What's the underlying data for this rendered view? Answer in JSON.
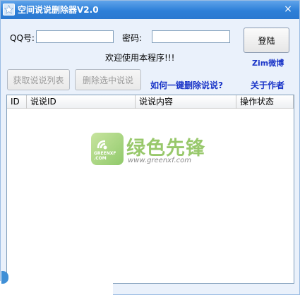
{
  "window": {
    "title": "空间说说删除器V2.0",
    "close_glyph": "×"
  },
  "form": {
    "qq_label": "QQ号:",
    "qq_value": "",
    "password_label": "密码:",
    "password_value": "",
    "login_button": "登陆",
    "welcome_text": "欢迎使用本程序!!!",
    "weibo_link": "Zim微博"
  },
  "actions": {
    "fetch_button": "获取说说列表",
    "delete_button": "删除选中说说",
    "one_click_link": "如何一键删除说说?",
    "about_link": "关于作者"
  },
  "list": {
    "columns": [
      "ID",
      "说说ID",
      "说说内容",
      "操作状态"
    ],
    "rows": []
  },
  "watermark": {
    "logo_text": "GREENXF .COM",
    "site_name": "绿色先锋",
    "url": "www.greenxf.com",
    "accent_color": "#8dc35c"
  }
}
